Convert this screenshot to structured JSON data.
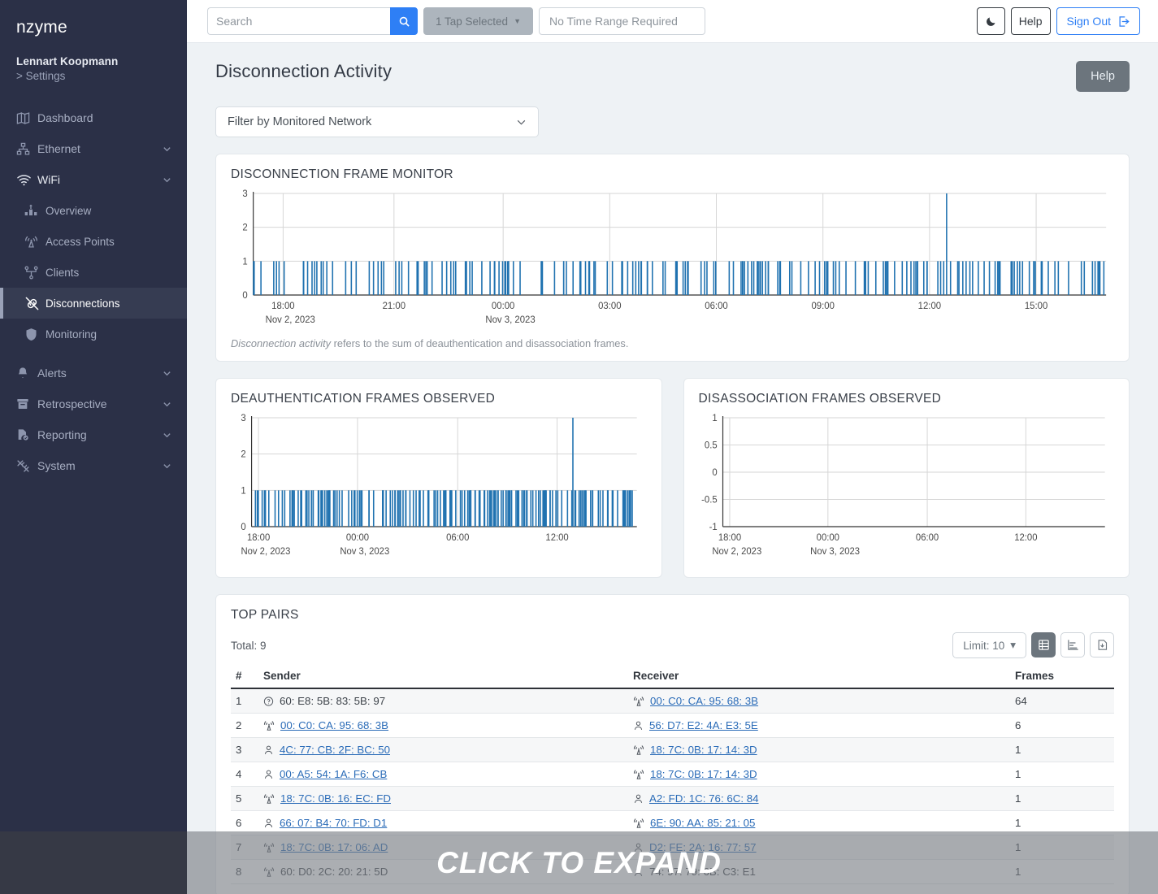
{
  "sidebar": {
    "brand": "nzyme",
    "user_name": "Lennart Koopmann",
    "user_settings": "> Settings",
    "items": [
      {
        "label": "Dashboard",
        "icon": "dashboard-icon",
        "expandable": false
      },
      {
        "label": "Ethernet",
        "icon": "ethernet-icon",
        "expandable": true
      },
      {
        "label": "WiFi",
        "icon": "wifi-icon",
        "expandable": true
      },
      {
        "label": "Overview",
        "icon": "overview-icon",
        "sub": true
      },
      {
        "label": "Access Points",
        "icon": "access-point-icon",
        "sub": true
      },
      {
        "label": "Clients",
        "icon": "clients-icon",
        "sub": true
      },
      {
        "label": "Disconnections",
        "icon": "disconnections-icon",
        "sub": true,
        "active": true
      },
      {
        "label": "Monitoring",
        "icon": "shield-icon",
        "sub": true
      },
      {
        "label": "Alerts",
        "icon": "bell-icon",
        "expandable": true
      },
      {
        "label": "Retrospective",
        "icon": "archive-icon",
        "expandable": true
      },
      {
        "label": "Reporting",
        "icon": "report-icon",
        "expandable": true
      },
      {
        "label": "System",
        "icon": "tools-icon",
        "expandable": true
      }
    ]
  },
  "topbar": {
    "search_placeholder": "Search",
    "search_value": "",
    "search_icon": "search-icon",
    "tap_selector_label": "1 Tap Selected",
    "time_range_label": "No Time Range Required",
    "dark_mode_icon": "moon-icon",
    "help_label": "Help",
    "sign_out_label": "Sign Out",
    "sign_out_icon": "sign-out-icon"
  },
  "page": {
    "title": "Disconnection Activity",
    "help_button": "Help",
    "network_filter_label": "Filter by Monitored Network",
    "network_filter_icon": "chevron-down-icon"
  },
  "monitor_card": {
    "title": "DISCONNECTION FRAME MONITOR",
    "note_italic": "Disconnection activity",
    "note_rest": " refers to the sum of deauthentication and disassociation frames."
  },
  "deauth_card": {
    "title": "DEAUTHENTICATION FRAMES OBSERVED"
  },
  "disassoc_card": {
    "title": "DISASSOCIATION FRAMES OBSERVED"
  },
  "top_pairs": {
    "title": "TOP PAIRS",
    "total_label": "Total: 9",
    "limit_label": "Limit: 10",
    "limit_caret": "chevron-down-icon",
    "view_table_icon": "table-view-icon",
    "view_chart_icon": "bar-chart-view-icon",
    "download_icon": "download-icon",
    "columns": [
      "#",
      "Sender",
      "Receiver",
      "Frames"
    ],
    "rows": [
      {
        "num": "1",
        "sender": "60: E8: 5B: 83: 5B: 97",
        "sender_icon": "unknown-device-icon",
        "sender_link": false,
        "receiver": "00: C0: CA: 95: 68: 3B",
        "receiver_icon": "access-point-icon",
        "receiver_link": true,
        "frames": "64"
      },
      {
        "num": "2",
        "sender": "00: C0: CA: 95: 68: 3B",
        "sender_icon": "access-point-icon",
        "sender_link": true,
        "receiver": "56: D7: E2: 4A: E3: 5E",
        "receiver_icon": "client-icon",
        "receiver_link": true,
        "frames": "6"
      },
      {
        "num": "3",
        "sender": "4C: 77: CB: 2F: BC: 50",
        "sender_icon": "client-icon",
        "sender_link": true,
        "receiver": "18: 7C: 0B: 17: 14: 3D",
        "receiver_icon": "access-point-icon",
        "receiver_link": true,
        "frames": "1"
      },
      {
        "num": "4",
        "sender": "00: A5: 54: 1A: F6: CB",
        "sender_icon": "client-icon",
        "sender_link": true,
        "receiver": "18: 7C: 0B: 17: 14: 3D",
        "receiver_icon": "access-point-icon",
        "receiver_link": true,
        "frames": "1"
      },
      {
        "num": "5",
        "sender": "18: 7C: 0B: 16: EC: FD",
        "sender_icon": "access-point-icon",
        "sender_link": true,
        "receiver": "A2: FD: 1C: 76: 6C: 84",
        "receiver_icon": "client-icon",
        "receiver_link": true,
        "frames": "1"
      },
      {
        "num": "6",
        "sender": "66: 07: B4: 70: FD: D1",
        "sender_icon": "client-icon",
        "sender_link": true,
        "receiver": "6E: 90: AA: 85: 21: 05",
        "receiver_icon": "access-point-icon",
        "receiver_link": true,
        "frames": "1"
      },
      {
        "num": "7",
        "sender": "18: 7C: 0B: 17: 06: AD",
        "sender_icon": "access-point-icon",
        "sender_link": true,
        "receiver": "D2: FE: 2A: 16: 77: 57",
        "receiver_icon": "client-icon",
        "receiver_link": true,
        "frames": "1"
      },
      {
        "num": "8",
        "sender": "60: D0: 2C: 20: 21: 5D",
        "sender_icon": "access-point-icon",
        "sender_link": false,
        "receiver": "74: 97: 79: 6B: C3: E1",
        "receiver_icon": "client-icon",
        "receiver_link": false,
        "frames": "1"
      }
    ]
  },
  "overlay": {
    "label": "CLICK TO EXPAND"
  },
  "colors": {
    "accent_blue": "#2e7ff5",
    "bar_blue": "#2072b0",
    "sidebar_bg": "#2b3047",
    "page_bg": "#eef2f5",
    "link_blue": "#2b6cb8"
  },
  "chart_data": [
    {
      "id": "disconnection_frame_monitor",
      "type": "bar",
      "title": "DISCONNECTION FRAME MONITOR",
      "xlabel": "",
      "ylabel": "",
      "ylim": [
        0,
        3
      ],
      "yticks": [
        0,
        1,
        2,
        3
      ],
      "grid": true,
      "legend": "none",
      "xticks": [
        "18:00",
        "21:00",
        "00:00",
        "03:00",
        "06:00",
        "09:00",
        "12:00",
        "15:00"
      ],
      "xtick_dates": {
        "18:00": "Nov 2, 2023",
        "00:00": "Nov 3, 2023"
      },
      "x_start_label": "Nov 2, 2023",
      "x_axis_note": "times span Nov 2 17:20 to Nov 3 17:00",
      "values": [
        {
          "t": 0.9,
          "v": 1
        },
        {
          "t": 2.4,
          "v": 1
        },
        {
          "t": 5.9,
          "v": 1
        },
        {
          "t": 8.2,
          "v": 1
        },
        {
          "t": 9.3,
          "v": 1
        },
        {
          "t": 11.5,
          "v": 1
        },
        {
          "t": 13.6,
          "v": 1
        },
        {
          "t": 14.1,
          "v": 1
        },
        {
          "t": 15.3,
          "v": 1
        },
        {
          "t": 16.7,
          "v": 1
        },
        {
          "t": 17.1,
          "v": 1
        },
        {
          "t": 18.2,
          "v": 1
        },
        {
          "t": 23.5,
          "v": 1
        },
        {
          "t": 25.0,
          "v": 1
        },
        {
          "t": 26.8,
          "v": 1
        },
        {
          "t": 29.6,
          "v": 1
        },
        {
          "t": 30.5,
          "v": 1
        },
        {
          "t": 33.8,
          "v": 1
        },
        {
          "t": 36.4,
          "v": 1
        },
        {
          "t": 37.5,
          "v": 1
        },
        {
          "t": 39.4,
          "v": 1
        },
        {
          "t": 40.1,
          "v": 1
        },
        {
          "t": 43.3,
          "v": 1
        },
        {
          "t": 43.9,
          "v": 1
        },
        {
          "t": 44.5,
          "v": 1
        },
        {
          "t": 46.8,
          "v": 1
        },
        {
          "t": 48.3,
          "v": 1
        },
        {
          "t": 49.7,
          "v": 1
        },
        {
          "t": 51.0,
          "v": 1
        },
        {
          "t": 53.2,
          "v": 1
        },
        {
          "t": 54.0,
          "v": 1
        },
        {
          "t": 56.3,
          "v": 1
        },
        {
          "t": 57.2,
          "v": 1
        },
        {
          "t": 58.0,
          "v": 1
        },
        {
          "t": 59.1,
          "v": 1
        },
        {
          "t": 60.4,
          "v": 1
        },
        {
          "t": 61.5,
          "v": 1
        },
        {
          "t": 62.9,
          "v": 1
        },
        {
          "t": 64.2,
          "v": 1
        },
        {
          "t": 65.1,
          "v": 1
        },
        {
          "t": 66.4,
          "v": 1
        },
        {
          "t": 67.0,
          "v": 1
        },
        {
          "t": 68.3,
          "v": 1
        },
        {
          "t": 69.5,
          "v": 1
        },
        {
          "t": 70.6,
          "v": 1
        },
        {
          "t": 71.8,
          "v": 1
        },
        {
          "t": 73.0,
          "v": 1
        },
        {
          "t": 74.4,
          "v": 1
        },
        {
          "t": 75.2,
          "v": 1
        },
        {
          "t": 76.1,
          "v": 1
        },
        {
          "t": 77.9,
          "v": 1
        },
        {
          "t": 79.0,
          "v": 1
        },
        {
          "t": 80.6,
          "v": 1
        },
        {
          "t": 81.3,
          "v": 3
        },
        {
          "t": 82.6,
          "v": 1
        },
        {
          "t": 83.2,
          "v": 1
        },
        {
          "t": 85.7,
          "v": 1
        },
        {
          "t": 87.3,
          "v": 1
        },
        {
          "t": 89.0,
          "v": 1
        },
        {
          "t": 89.6,
          "v": 1
        },
        {
          "t": 90.2,
          "v": 1
        },
        {
          "t": 91.0,
          "v": 1
        },
        {
          "t": 91.7,
          "v": 1
        },
        {
          "t": 92.5,
          "v": 1
        },
        {
          "t": 94.0,
          "v": 1
        },
        {
          "t": 95.6,
          "v": 1
        },
        {
          "t": 97.1,
          "v": 1
        },
        {
          "t": 98.4,
          "v": 1
        },
        {
          "t": 99.2,
          "v": 1
        }
      ]
    },
    {
      "id": "deauthentication_frames_observed",
      "type": "bar",
      "title": "DEAUTHENTICATION FRAMES OBSERVED",
      "xlabel": "",
      "ylabel": "",
      "ylim": [
        0,
        3
      ],
      "yticks": [
        0,
        1,
        2,
        3
      ],
      "grid": true,
      "legend": "none",
      "xticks": [
        "18:00",
        "00:00",
        "06:00",
        "12:00"
      ],
      "xtick_dates": {
        "18:00": "Nov 2, 2023",
        "00:00": "Nov 3, 2023"
      },
      "values": [
        {
          "t": 1.0,
          "v": 1
        },
        {
          "t": 3.5,
          "v": 1
        },
        {
          "t": 7.0,
          "v": 1
        },
        {
          "t": 8.6,
          "v": 1
        },
        {
          "t": 10.5,
          "v": 1
        },
        {
          "t": 12.1,
          "v": 1
        },
        {
          "t": 13.0,
          "v": 1
        },
        {
          "t": 14.4,
          "v": 1
        },
        {
          "t": 16.0,
          "v": 1
        },
        {
          "t": 17.3,
          "v": 1
        },
        {
          "t": 19.0,
          "v": 1
        },
        {
          "t": 23.5,
          "v": 1
        },
        {
          "t": 25.2,
          "v": 1
        },
        {
          "t": 26.0,
          "v": 1
        },
        {
          "t": 28.0,
          "v": 1
        },
        {
          "t": 30.5,
          "v": 1
        },
        {
          "t": 34.0,
          "v": 1
        },
        {
          "t": 36.0,
          "v": 1
        },
        {
          "t": 37.2,
          "v": 1
        },
        {
          "t": 38.6,
          "v": 1
        },
        {
          "t": 40.0,
          "v": 1
        },
        {
          "t": 42.0,
          "v": 1
        },
        {
          "t": 43.5,
          "v": 1
        },
        {
          "t": 44.6,
          "v": 1
        },
        {
          "t": 46.0,
          "v": 1
        },
        {
          "t": 47.8,
          "v": 1
        },
        {
          "t": 49.0,
          "v": 1
        },
        {
          "t": 50.4,
          "v": 1
        },
        {
          "t": 51.5,
          "v": 1
        },
        {
          "t": 53.0,
          "v": 1
        },
        {
          "t": 54.2,
          "v": 1
        },
        {
          "t": 55.3,
          "v": 1
        },
        {
          "t": 56.5,
          "v": 1
        },
        {
          "t": 58.0,
          "v": 1
        },
        {
          "t": 59.3,
          "v": 1
        },
        {
          "t": 60.5,
          "v": 1
        },
        {
          "t": 62.0,
          "v": 1
        },
        {
          "t": 63.4,
          "v": 1
        },
        {
          "t": 64.8,
          "v": 1
        },
        {
          "t": 66.0,
          "v": 1
        },
        {
          "t": 67.5,
          "v": 1
        },
        {
          "t": 69.0,
          "v": 1
        },
        {
          "t": 70.2,
          "v": 1
        },
        {
          "t": 71.5,
          "v": 1
        },
        {
          "t": 73.0,
          "v": 1
        },
        {
          "t": 74.5,
          "v": 1
        },
        {
          "t": 76.0,
          "v": 1
        },
        {
          "t": 77.5,
          "v": 1
        },
        {
          "t": 79.0,
          "v": 1
        },
        {
          "t": 80.5,
          "v": 1
        },
        {
          "t": 82.0,
          "v": 1
        },
        {
          "t": 83.4,
          "v": 3
        },
        {
          "t": 85.0,
          "v": 1
        },
        {
          "t": 85.8,
          "v": 1
        },
        {
          "t": 88.0,
          "v": 1
        },
        {
          "t": 90.0,
          "v": 1
        },
        {
          "t": 91.2,
          "v": 1
        },
        {
          "t": 92.4,
          "v": 1
        },
        {
          "t": 93.8,
          "v": 1
        },
        {
          "t": 95.0,
          "v": 1
        },
        {
          "t": 96.5,
          "v": 1
        },
        {
          "t": 97.6,
          "v": 1
        },
        {
          "t": 98.8,
          "v": 1
        }
      ]
    },
    {
      "id": "disassociation_frames_observed",
      "type": "bar",
      "title": "DISASSOCIATION FRAMES OBSERVED",
      "xlabel": "",
      "ylabel": "",
      "ylim": [
        -1,
        1
      ],
      "yticks": [
        -1,
        -0.5,
        0,
        0.5,
        1
      ],
      "ytick_labels": [
        "-1",
        "-0.5",
        "0",
        "0.5",
        "1"
      ],
      "grid": true,
      "legend": "none",
      "xticks": [
        "18:00",
        "00:00",
        "06:00",
        "12:00"
      ],
      "xtick_dates": {
        "18:00": "Nov 2, 2023",
        "00:00": "Nov 3, 2023"
      },
      "values": []
    }
  ]
}
